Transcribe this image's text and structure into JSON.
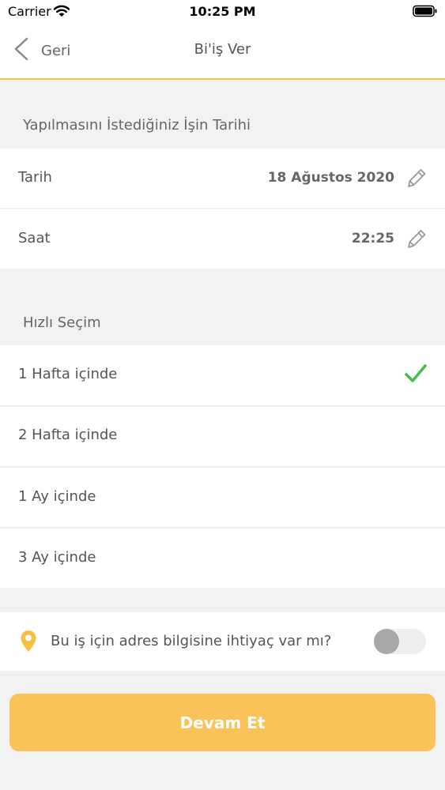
{
  "status_bar": {
    "carrier": "Carrier",
    "time": "10:25 PM"
  },
  "nav": {
    "back_label": "Geri",
    "title": "Bi'iş Ver"
  },
  "date_section": {
    "header": "Yapılmasını İstediğiniz İşin Tarihi",
    "date_label": "Tarih",
    "date_value": "18 Ağustos 2020",
    "time_label": "Saat",
    "time_value": "22:25"
  },
  "quick_select": {
    "header": "Hızlı Seçim",
    "options": [
      {
        "label": "1 Hafta içinde",
        "selected": true
      },
      {
        "label": "2 Hafta içinde",
        "selected": false
      },
      {
        "label": "1 Ay içinde",
        "selected": false
      },
      {
        "label": "3 Ay içinde",
        "selected": false
      }
    ]
  },
  "address": {
    "label": "Bu iş için adres bilgisine ihtiyaç var mı?",
    "enabled": false
  },
  "continue_label": "Devam Et",
  "colors": {
    "accent": "#fac35a",
    "nav_border": "#f5c04a",
    "check": "#4cbb46",
    "pin": "#f7c044"
  }
}
